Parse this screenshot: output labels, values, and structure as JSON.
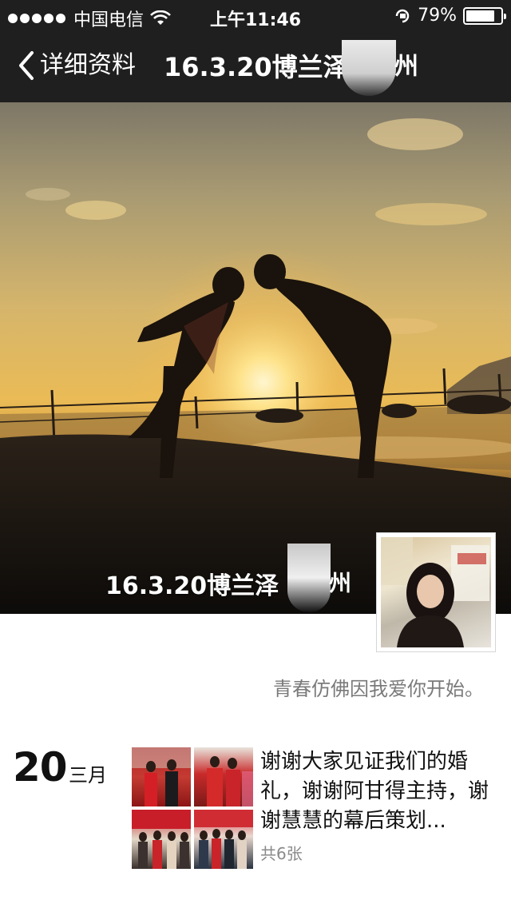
{
  "status_bar": {
    "carrier": "中国电信",
    "time": "上午11:46",
    "battery_text": "79%"
  },
  "nav": {
    "back_label": "详细资料",
    "title": "16.3.20博兰泽",
    "title_tail": "州"
  },
  "cover": {
    "title": "16.3.20博兰泽",
    "title_tail": "州"
  },
  "profile": {
    "signature": "青春仿佛因我爱你开始。"
  },
  "moment": {
    "day": "20",
    "month": "三月",
    "text": "谢谢大家见证我们的婚礼，谢谢阿甘得主持，谢谢慧慧的幕后策划...",
    "photo_count": "共6张"
  },
  "icons": [
    "wifi-icon",
    "back-chevron-icon",
    "rotation-lock-icon",
    "battery-icon"
  ],
  "colors": {
    "nav_background": "#1f1f1f",
    "text_primary": "#111111",
    "text_secondary": "#7a7a7a"
  }
}
